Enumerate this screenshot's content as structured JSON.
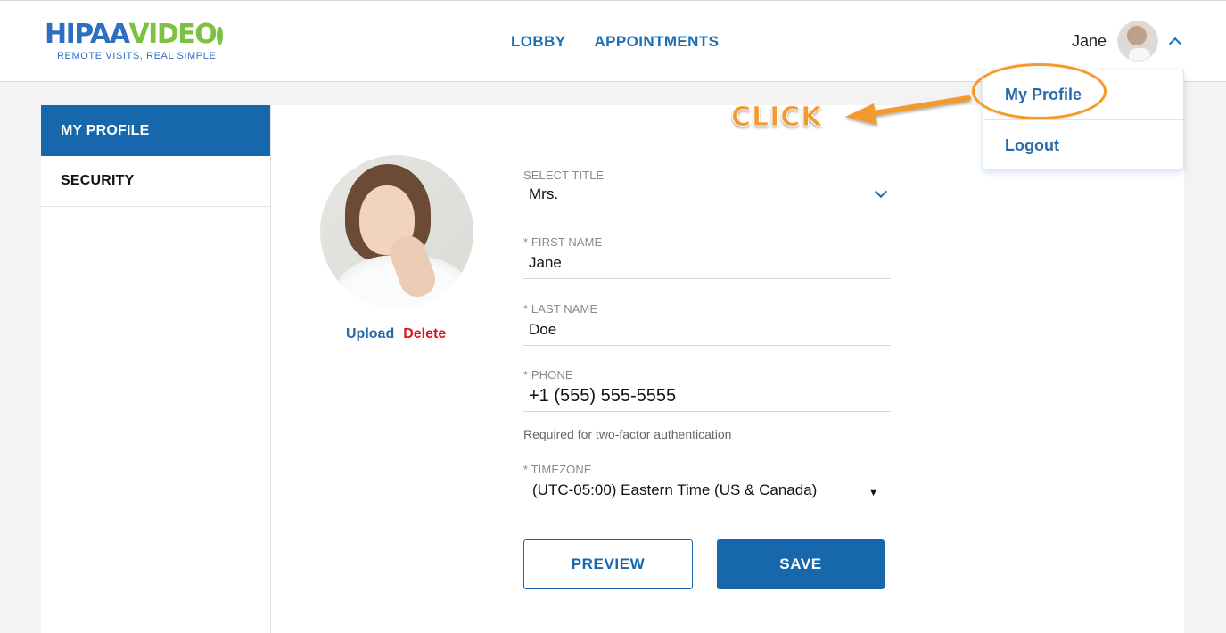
{
  "header": {
    "logo": {
      "brand_part1": "HIPAA",
      "brand_part2": "VIDEO",
      "tagline": "REMOTE VISITS, REAL SIMPLE"
    },
    "nav": [
      {
        "label": "LOBBY"
      },
      {
        "label": "APPOINTMENTS"
      }
    ],
    "user": {
      "name": "Jane"
    }
  },
  "dropdown": {
    "items": [
      {
        "label": "My Profile"
      },
      {
        "label": "Logout"
      }
    ]
  },
  "annotation": {
    "text": "CLICK",
    "color": "#f39a2e"
  },
  "sidebar": {
    "items": [
      {
        "label": "MY PROFILE",
        "active": true
      },
      {
        "label": "SECURITY",
        "active": false
      }
    ]
  },
  "profile": {
    "photo_actions": {
      "upload": "Upload",
      "delete": "Delete"
    },
    "fields": {
      "title": {
        "label": "SELECT TITLE",
        "value": "Mrs."
      },
      "first_name": {
        "label": "* FIRST NAME",
        "value": "Jane"
      },
      "last_name": {
        "label": "* LAST NAME",
        "value": "Doe"
      },
      "phone": {
        "label": "* PHONE",
        "value": "+1 (555) 555-5555",
        "help": "Required for two-factor authentication"
      },
      "timezone": {
        "label": "* TIMEZONE",
        "value": "(UTC-05:00) Eastern Time (US & Canada)"
      }
    },
    "buttons": {
      "preview": "PREVIEW",
      "save": "SAVE"
    }
  },
  "colors": {
    "primary": "#1767ad",
    "link": "#2a6aa8",
    "danger": "#e0141e",
    "brand_green": "#7cc142"
  }
}
